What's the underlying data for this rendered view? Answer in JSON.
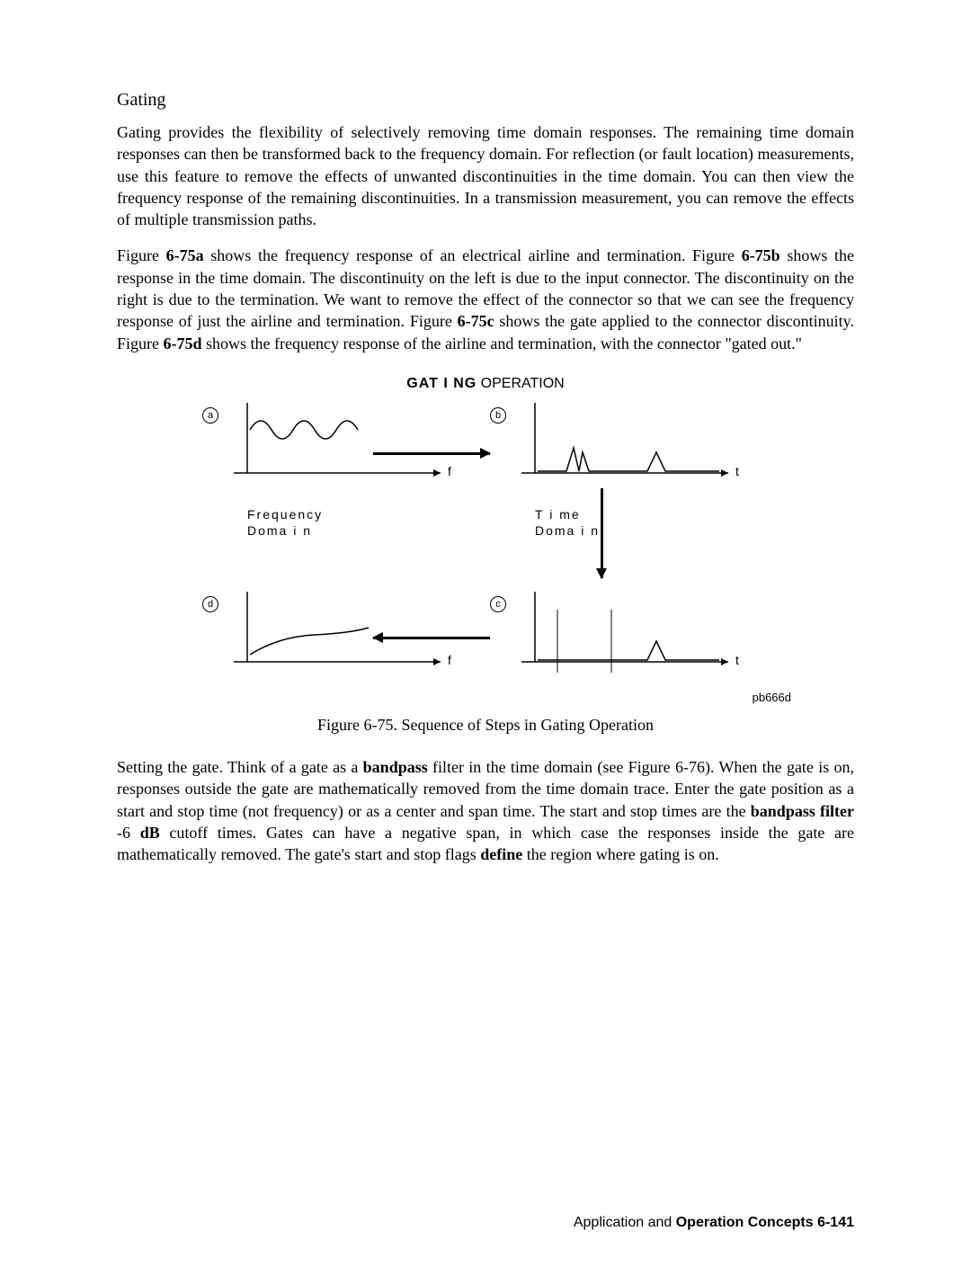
{
  "section_title": "Gating",
  "para1": "Gating provides the flexibility of selectively removing time domain responses. The remaining time domain responses can then be transformed back to the frequency domain. For reflection (or fault location) measurements, use this feature to remove the effects of unwanted discontinuities in the time domain. You can then view the frequency response of the remaining discontinuities. In a transmission measurement, you can remove the effects of multiple transmission paths.",
  "para2_parts": {
    "p1": "Figure ",
    "b1": "6-75a",
    "p2": " shows the frequency response of an electrical airline and termination. Figure ",
    "b2": "6-75b",
    "p3": " shows the response in the time domain. The discontinuity on the left is due to the input connector. The discontinuity on the right is due to the termination. We want to remove the effect of the connector so that we can see the frequency response of just the airline and termination. Figure ",
    "b3": "6-75c",
    "p4": " shows the gate applied to the connector discontinuity. Figure ",
    "b4": "6-75d",
    "p5": " shows the frequency response of the airline and termination, with the connector \"gated out.\""
  },
  "figure": {
    "title_bold": "GAT I NG",
    "title_rest": " OPERATION",
    "label_a": "a",
    "label_b": "b",
    "label_c": "c",
    "label_d": "d",
    "axis_f": "f",
    "axis_t": "t",
    "freq_label_line1": "Frequency",
    "freq_label_line2": "Doma i n",
    "time_label_line1": "T i me",
    "time_label_line2": "Doma i n",
    "source": "pb666d",
    "caption": "Figure 6-75. Sequence of Steps in Gating Operation"
  },
  "para3_parts": {
    "p1": "Setting the gate. Think of a gate as a ",
    "b1": "bandpass",
    "p2": " filter in the time domain (see Figure 6-76). When the gate is on, responses outside the gate are mathematically removed from the time domain trace. Enter the gate position as a start and stop time (not frequency) or as a center and span time. The start and stop times are the ",
    "b2": "bandpass filter",
    "p3": " -6 ",
    "b3": "dB",
    "p4": " cutoff times. Gates can have a negative span, in which case the responses inside the gate are mathematically removed. The gate's start and stop flags ",
    "b4": "define",
    "p5": " the region where gating is on."
  },
  "footer_parts": {
    "p1": "Application and ",
    "b1": "Operation Concepts 6-141"
  }
}
